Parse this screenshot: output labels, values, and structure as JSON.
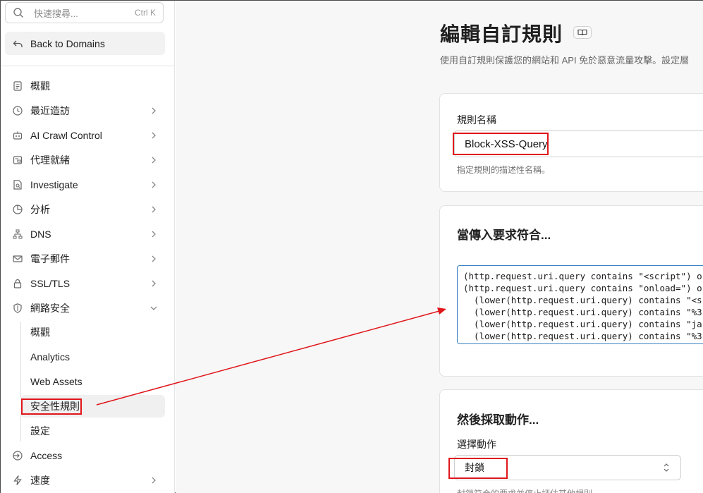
{
  "search": {
    "placeholder": "快速搜尋...",
    "shortcut": "Ctrl K"
  },
  "back_label": "Back to Domains",
  "nav": [
    {
      "label": "概觀",
      "icon": "document-icon",
      "chevron": ""
    },
    {
      "label": "最近造訪",
      "icon": "history-icon",
      "chevron": "right"
    },
    {
      "label": "AI Crawl Control",
      "icon": "robot-icon",
      "chevron": "right"
    },
    {
      "label": "代理就緒",
      "icon": "proxy-icon",
      "chevron": "right"
    },
    {
      "label": "Investigate",
      "icon": "file-search-icon",
      "chevron": "right"
    },
    {
      "label": "分析",
      "icon": "pie-chart-icon",
      "chevron": "right"
    },
    {
      "label": "DNS",
      "icon": "network-icon",
      "chevron": "right"
    },
    {
      "label": "電子郵件",
      "icon": "mail-icon",
      "chevron": "right"
    },
    {
      "label": "SSL/TLS",
      "icon": "lock-icon",
      "chevron": "right"
    },
    {
      "label": "網路安全",
      "icon": "shield-icon",
      "chevron": "down"
    }
  ],
  "security_sub": [
    {
      "label": "概觀"
    },
    {
      "label": "Analytics"
    },
    {
      "label": "Web Assets"
    },
    {
      "label": "安全性規則"
    },
    {
      "label": "設定"
    }
  ],
  "nav_bottom": [
    {
      "label": "Access",
      "icon": "access-icon",
      "chevron": ""
    },
    {
      "label": "速度",
      "icon": "lightning-icon",
      "chevron": "right"
    }
  ],
  "page": {
    "title": "編輯自訂規則",
    "subtitle": "使用自訂規則保護您的網站和 API 免於惡意流量攻擊。設定層"
  },
  "rule_name": {
    "label": "規則名稱",
    "value": "Block-XSS-Query",
    "hint": "指定規則的描述性名稱。"
  },
  "match": {
    "heading": "當傳入要求符合...",
    "expression_lines": [
      "(http.request.uri.query contains \"<script\") or",
      "(http.request.uri.query contains \"onload=\") or",
      "  (lower(http.request.uri.query) contains \"<s",
      "  (lower(http.request.uri.query) contains \"%3",
      "  (lower(http.request.uri.query) contains \"ja",
      "  (lower(http.request.uri.query) contains \"%3"
    ]
  },
  "action": {
    "heading": "然後採取動作...",
    "label": "選擇動作",
    "selected": "封鎖",
    "hint": "封鎖符合的要求並停止評估其他規則"
  },
  "colors": {
    "annotation": "#e0161b",
    "focus": "#3b82c4"
  }
}
